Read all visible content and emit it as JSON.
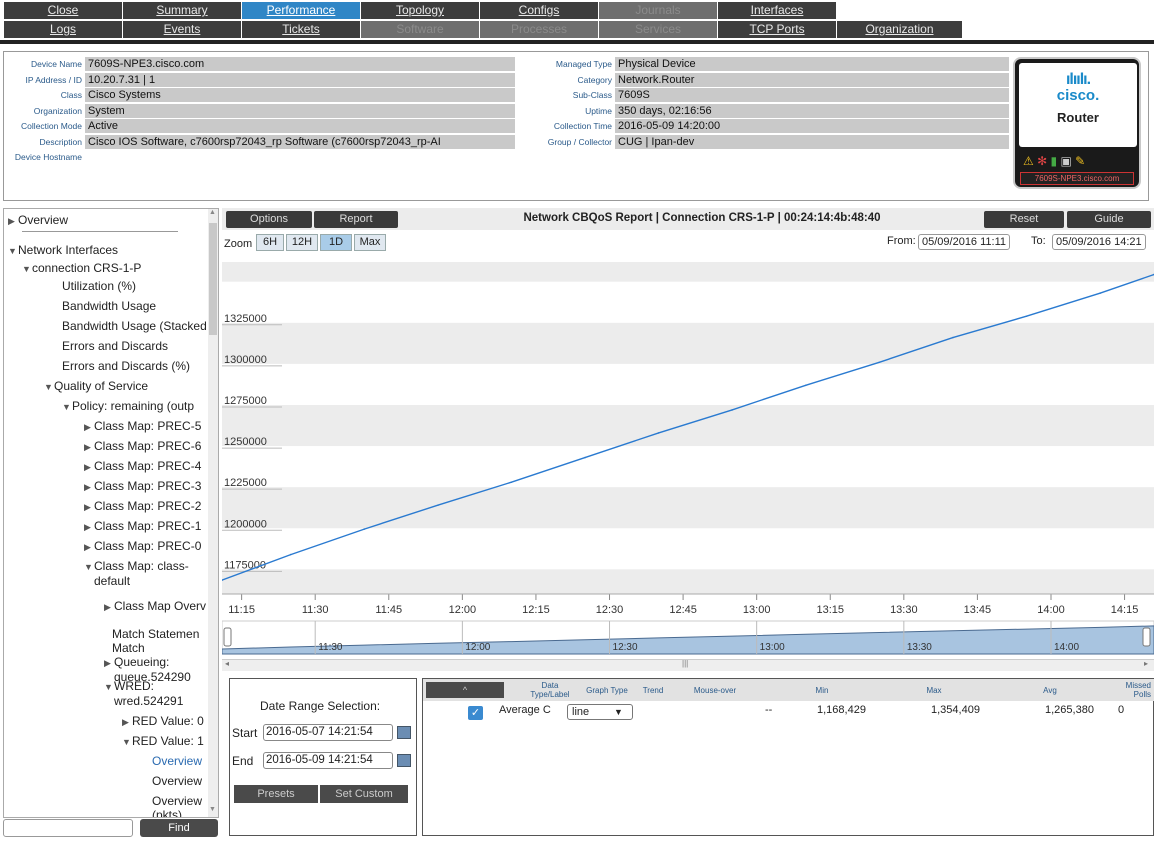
{
  "nav": {
    "row1": [
      {
        "label": "Close",
        "state": "normal"
      },
      {
        "label": "Summary",
        "state": "normal"
      },
      {
        "label": "Performance",
        "state": "active"
      },
      {
        "label": "Topology",
        "state": "normal"
      },
      {
        "label": "Configs",
        "state": "normal"
      },
      {
        "label": "Journals",
        "state": "disabled"
      },
      {
        "label": "Interfaces",
        "state": "normal"
      }
    ],
    "row2": [
      {
        "label": "Logs",
        "state": "normal"
      },
      {
        "label": "Events",
        "state": "normal"
      },
      {
        "label": "Tickets",
        "state": "normal"
      },
      {
        "label": "Software",
        "state": "disabled"
      },
      {
        "label": "Processes",
        "state": "disabled"
      },
      {
        "label": "Services",
        "state": "disabled"
      },
      {
        "label": "TCP Ports",
        "state": "normal"
      },
      {
        "label": "Organization",
        "state": "normal"
      }
    ]
  },
  "device": {
    "left": [
      {
        "label": "Device Name",
        "value": "7609S-NPE3.cisco.com"
      },
      {
        "label": "IP Address / ID",
        "value": "10.20.7.31 | 1"
      },
      {
        "label": "Class",
        "value": "Cisco Systems"
      },
      {
        "label": "Organization",
        "value": "System"
      },
      {
        "label": "Collection Mode",
        "value": "Active"
      },
      {
        "label": "Description",
        "value": "Cisco IOS Software, c7600rsp72043_rp Software (c7600rsp72043_rp-AI"
      },
      {
        "label": "Device Hostname",
        "value": ""
      }
    ],
    "right": [
      {
        "label": "Managed Type",
        "value": "Physical Device"
      },
      {
        "label": "Category",
        "value": "Network.Router"
      },
      {
        "label": "Sub-Class",
        "value": "7609S"
      },
      {
        "label": "Uptime",
        "value": "350 days, 02:16:56"
      },
      {
        "label": "Collection Time",
        "value": "2016-05-09 14:20:00"
      },
      {
        "label": "Group / Collector",
        "value": "CUG | Ipan-dev"
      }
    ],
    "icon": {
      "brand": "cisco.",
      "type": "Router",
      "host_label": "7609S-NPE3.cisco.com",
      "brand_color": "#1a8ac9"
    }
  },
  "tree": {
    "items": [
      {
        "label": "Overview",
        "icon": "triangle-right-icon",
        "link": false
      },
      {
        "label": "Network Interfaces",
        "icon": "triangle-down-icon",
        "link": false
      },
      {
        "label": "connection CRS-1-P",
        "icon": "triangle-down-icon",
        "link": false
      },
      {
        "label": "Utilization (%)",
        "icon": "",
        "link": false
      },
      {
        "label": "Bandwidth Usage",
        "icon": "",
        "link": false
      },
      {
        "label": "Bandwidth Usage (Stacked",
        "icon": "",
        "link": false
      },
      {
        "label": "Errors and Discards",
        "icon": "",
        "link": false
      },
      {
        "label": "Errors and Discards (%)",
        "icon": "",
        "link": false
      },
      {
        "label": "Quality of Service",
        "icon": "triangle-down-icon",
        "link": false
      },
      {
        "label": "Policy: remaining (outp",
        "icon": "triangle-down-icon",
        "link": false
      },
      {
        "label": "Class Map: PREC-5",
        "icon": "triangle-right-icon",
        "link": false
      },
      {
        "label": "Class Map: PREC-6",
        "icon": "triangle-right-icon",
        "link": false
      },
      {
        "label": "Class Map: PREC-4",
        "icon": "triangle-right-icon",
        "link": false
      },
      {
        "label": "Class Map: PREC-3",
        "icon": "triangle-right-icon",
        "link": false
      },
      {
        "label": "Class Map: PREC-2",
        "icon": "triangle-right-icon",
        "link": false
      },
      {
        "label": "Class Map: PREC-1",
        "icon": "triangle-right-icon",
        "link": false
      },
      {
        "label": "Class Map: PREC-0",
        "icon": "triangle-right-icon",
        "link": false
      },
      {
        "label": "Class Map: class-",
        "label2": "default",
        "icon": "triangle-down-icon",
        "link": false
      },
      {
        "label": "Class Map Overv",
        "icon": "triangle-right-icon",
        "link": false
      },
      {
        "label": "Match Statemen",
        "label2": "Match",
        "icon": "",
        "link": false
      },
      {
        "label": "Queueing:",
        "label2": "queue.524290",
        "icon": "triangle-right-icon",
        "link": false
      },
      {
        "label": "WRED:",
        "label2": "wred.524291",
        "icon": "triangle-down-icon",
        "link": false
      },
      {
        "label": "RED Value: 0",
        "icon": "triangle-right-icon",
        "link": false
      },
      {
        "label": "RED Value: 1",
        "icon": "triangle-down-icon",
        "link": false
      },
      {
        "label": "Overview",
        "icon": "",
        "link": true
      },
      {
        "label": "Overview",
        "icon": "",
        "link": false
      },
      {
        "label": "Overview",
        "label2": "(pkts)",
        "icon": "",
        "link": false
      }
    ],
    "find_placeholder": "",
    "find_label": "Find"
  },
  "report": {
    "options_label": "Options",
    "report_label": "Report",
    "title": "Network CBQoS Report | Connection CRS-1-P | 00:24:14:4b:48:40",
    "reset_label": "Reset",
    "guide_label": "Guide",
    "zoom_label": "Zoom",
    "zoom_buttons": [
      "6H",
      "12H",
      "1D",
      "Max"
    ],
    "zoom_selected": "1D",
    "from_label": "From:",
    "from_value": "05/09/2016 11:11",
    "to_label": "To:",
    "to_value": "05/09/2016 14:21",
    "line_color": "#2a7ad0",
    "fill_color": "#a8c4e0"
  },
  "chart_data": {
    "type": "line",
    "title": "",
    "xlabel": "",
    "ylabel": "",
    "x_ticks": [
      "11:15",
      "11:30",
      "11:45",
      "12:00",
      "12:15",
      "12:30",
      "12:45",
      "13:00",
      "13:15",
      "13:30",
      "13:45",
      "14:00",
      "14:15"
    ],
    "y_ticks": [
      1175000,
      1200000,
      1225000,
      1250000,
      1275000,
      1300000,
      1325000
    ],
    "ylim": [
      1160000,
      1362000
    ],
    "xlim": [
      "11:11",
      "14:21"
    ],
    "series": [
      {
        "name": "Average C",
        "x": [
          "11:11",
          "11:25",
          "11:40",
          "11:55",
          "12:10",
          "12:25",
          "12:40",
          "12:55",
          "13:10",
          "13:25",
          "13:40",
          "13:55",
          "14:10",
          "14:21"
        ],
        "values": [
          1168429,
          1184000,
          1199500,
          1214000,
          1228000,
          1243000,
          1258000,
          1272000,
          1287000,
          1301000,
          1316000,
          1329000,
          1343000,
          1354409
        ]
      }
    ],
    "navigator_ticks": [
      "11:30",
      "12:00",
      "12:30",
      "13:00",
      "13:30",
      "14:00"
    ],
    "grid": true,
    "legend": "none"
  },
  "daterange": {
    "title": "Date Range Selection:",
    "start_label": "Start",
    "start_value": "2016-05-07 14:21:54",
    "end_label": "End",
    "end_value": "2016-05-09 14:21:54",
    "presets_label": "Presets",
    "set_custom_label": "Set Custom"
  },
  "legend_table": {
    "headers": {
      "data": "Data\nType/Label",
      "graph_type": "Graph Type",
      "trend": "Trend",
      "mouse_over": "Mouse-over",
      "min": "Min",
      "max": "Max",
      "avg": "Avg",
      "missed": "Missed\nPolls"
    },
    "sort_label": "^",
    "row": {
      "label": "Average C",
      "graph_type": "line",
      "trend": "",
      "mouse_over": "--",
      "min": "1,168,429",
      "max": "1,354,409",
      "avg": "1,265,380",
      "missed": "0"
    }
  }
}
